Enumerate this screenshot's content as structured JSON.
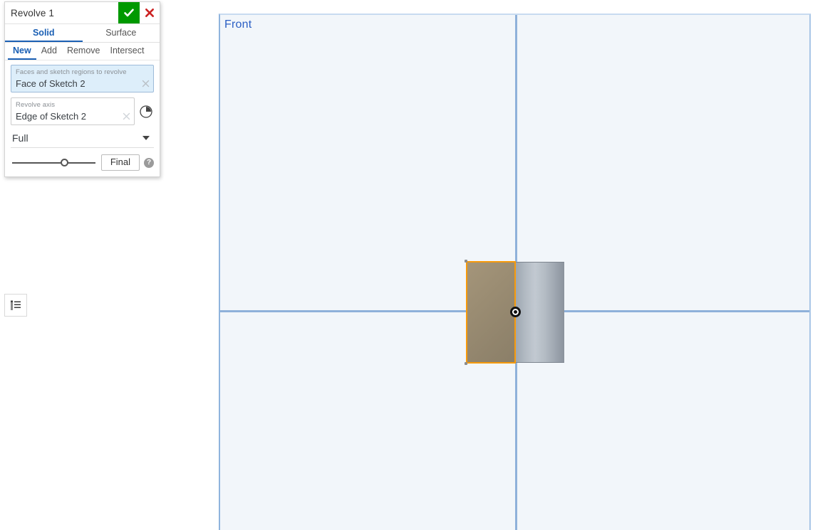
{
  "dialog": {
    "title": "Revolve 1",
    "accept_icon": "checkmark-icon",
    "cancel_icon": "close-x-icon",
    "accept_color": "#009900",
    "cancel_color": "#cc2222",
    "primary_tabs": [
      {
        "label": "Solid",
        "active": true
      },
      {
        "label": "Surface",
        "active": false
      }
    ],
    "secondary_tabs": [
      {
        "label": "New",
        "active": true
      },
      {
        "label": "Add",
        "active": false
      },
      {
        "label": "Remove",
        "active": false
      },
      {
        "label": "Intersect",
        "active": false
      }
    ],
    "faces_field": {
      "label": "Faces and sketch regions to revolve",
      "value": "Face of Sketch 2",
      "clear_icon": "close-x-icon"
    },
    "axis_field": {
      "label": "Revolve axis",
      "value": "Edge of Sketch 2",
      "clear_icon": "close-x-icon",
      "side_icon": "clock-angle-icon"
    },
    "revolve_type": {
      "value": "Full",
      "caret_icon": "chevron-down-icon",
      "options": [
        "Full"
      ]
    },
    "slider": {
      "position_percent": 62
    },
    "final_button": {
      "label": "Final"
    },
    "help_icon": {
      "glyph": "?"
    }
  },
  "left_rail": {
    "feature_list_toggle": {
      "icon": "feature-list-icon"
    }
  },
  "viewport": {
    "view_label": "Front",
    "view_label_color": "#2b5fc4",
    "background_color": "#f2f6fa",
    "axis_color": "#8fb1da",
    "model": {
      "sketch_face_highlight_color": "#f79a0b",
      "sketch_face_fill_color": "#998a70",
      "revolved_body_color": "#b2bac3",
      "origin_point": "origin-point-marker"
    }
  }
}
